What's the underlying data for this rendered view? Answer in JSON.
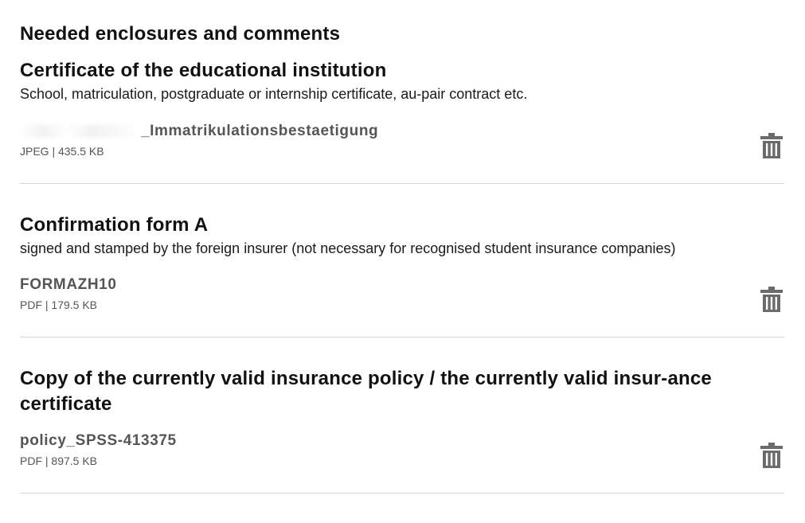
{
  "page": {
    "title": "Needed enclosures and comments"
  },
  "sections": [
    {
      "title": "Certificate of the educational institution",
      "description": "School, matriculation, postgraduate or internship certificate, au-pair contract etc.",
      "file": {
        "name": "_Immatrikulationsbestaetigung",
        "meta": "JPEG | 435.5 KB"
      }
    },
    {
      "title": "Confirmation form A",
      "description": "signed and stamped by the foreign insurer (not necessary for recognised student insurance companies)",
      "file": {
        "name": "FORMAZH10",
        "meta": "PDF | 179.5 KB"
      }
    },
    {
      "title": "Copy of the currently valid insurance policy / the currently valid insur-ance certificate",
      "file": {
        "name": "policy_SPSS-413375",
        "meta": "PDF | 897.5 KB"
      }
    }
  ],
  "icons": {
    "delete": "trash-icon"
  },
  "colors": {
    "text": "#111111",
    "muted": "#555555",
    "icon": "#6b6b6b",
    "divider": "#d6d6d6"
  }
}
